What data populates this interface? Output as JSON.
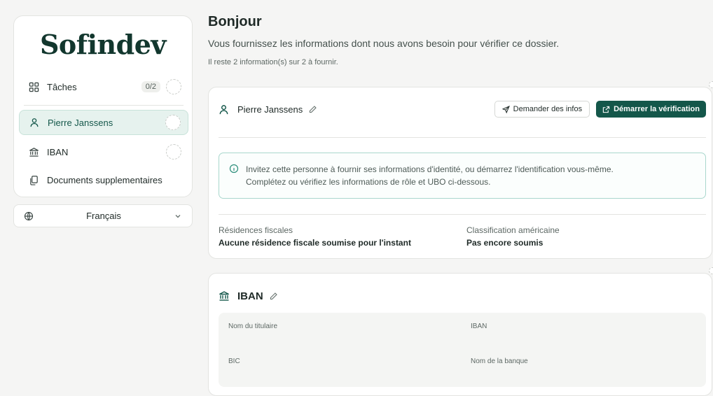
{
  "brand": {
    "logo": "Sofindev"
  },
  "sidebar": {
    "items": [
      {
        "label": "Tâches",
        "badge": "0/2",
        "icon": "grid-icon"
      },
      {
        "label": "Pierre Janssens",
        "icon": "person-icon",
        "active": true
      },
      {
        "label": "IBAN",
        "icon": "bank-icon"
      },
      {
        "label": "Documents supplementaires",
        "icon": "documents-icon"
      }
    ]
  },
  "language": {
    "label": "Français",
    "icon": "globe-icon"
  },
  "header": {
    "title": "Bonjour",
    "subtitle": "Vous fournissez les informations dont nous avons besoin pour vérifier ce dossier.",
    "remaining": "Il reste 2 information(s) sur 2 à fournir."
  },
  "person_card": {
    "name": "Pierre Janssens",
    "request_label": "Demander des infos",
    "start_label": "Démarrer la vérification",
    "info_line1": "Invitez cette personne à fournir ses informations d'identité, ou démarrez l'identification vous-même.",
    "info_line2": "Complétez ou vérifiez les informations de rôle et UBO ci-dessous.",
    "fiscal_label": "Résidences fiscales",
    "fiscal_value": "Aucune résidence fiscale soumise pour l'instant",
    "us_label": "Classification américaine",
    "us_value": "Pas encore soumis"
  },
  "iban_card": {
    "title": "IBAN",
    "holder_label": "Nom du titulaire",
    "iban_label": "IBAN",
    "bic_label": "BIC",
    "bank_label": "Nom de la banque"
  },
  "colors": {
    "accent": "#14574a",
    "background": "#f5f5f4",
    "info_border": "#a9d7cd"
  }
}
